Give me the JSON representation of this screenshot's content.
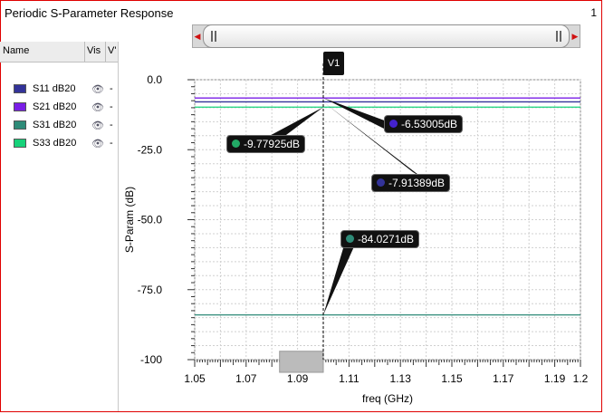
{
  "window": {
    "title": "Periodic S-Parameter Response",
    "page": "1"
  },
  "legend": {
    "headers": {
      "name": "Name",
      "vis": "Vis",
      "v": "V'"
    },
    "items": [
      {
        "label": "S11 dB20",
        "color": "#333399",
        "vis": "-"
      },
      {
        "label": "S21 dB20",
        "color": "#7a1ee6",
        "vis": "-"
      },
      {
        "label": "S31 dB20",
        "color": "#2e8b78",
        "vis": "-"
      },
      {
        "label": "S33 dB20",
        "color": "#17d27a",
        "vis": "-"
      }
    ]
  },
  "cursor": {
    "label": "V1",
    "x": 1.1
  },
  "markers": [
    {
      "label": "-6.53005dB",
      "color": "#4422cc",
      "series": "S21 dB20"
    },
    {
      "label": "-7.91389dB",
      "color": "#333399",
      "series": "S11 dB20"
    },
    {
      "label": "-9.77925dB",
      "color": "#22aa66",
      "series": "S33 dB20"
    },
    {
      "label": "-84.0271dB",
      "color": "#2e8b78",
      "series": "S31 dB20"
    }
  ],
  "chart_data": {
    "type": "line",
    "xlabel": "freq (GHz)",
    "ylabel": "S-Param (dB)",
    "xlim": [
      1.05,
      1.2
    ],
    "ylim": [
      -100,
      0
    ],
    "xticks": [
      "1.05",
      "1.07",
      "1.09",
      "1.11",
      "1.13",
      "1.15",
      "1.17",
      "1.19",
      "1.2"
    ],
    "yticks": [
      "0.0",
      "-25.0",
      "-50.0",
      "-75.0",
      "-100"
    ],
    "grid": true,
    "series": [
      {
        "name": "S21 dB20",
        "color": "#7a1ee6",
        "x": [
          1.05,
          1.2
        ],
        "y": [
          -6.53,
          -6.53
        ]
      },
      {
        "name": "S11 dB20",
        "color": "#333399",
        "x": [
          1.05,
          1.2
        ],
        "y": [
          -7.91,
          -7.91
        ]
      },
      {
        "name": "S33 dB20",
        "color": "#17d27a",
        "x": [
          1.05,
          1.2
        ],
        "y": [
          -9.78,
          -9.78
        ]
      },
      {
        "name": "S31 dB20",
        "color": "#2e8b78",
        "x": [
          1.05,
          1.2
        ],
        "y": [
          -84.03,
          -84.03
        ]
      }
    ]
  }
}
